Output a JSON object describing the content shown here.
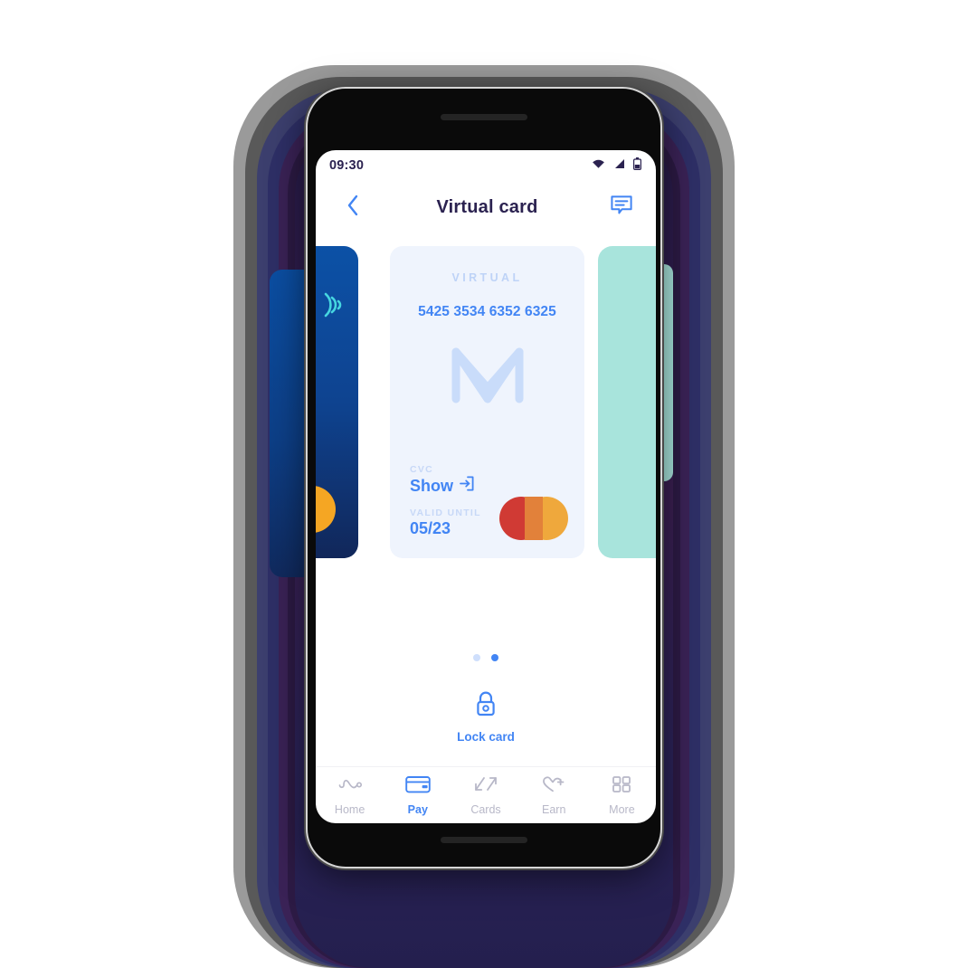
{
  "background": {
    "ring_colors": [
      "#ffffff",
      "#9a9a9a",
      "#595959",
      "#3c3f6e",
      "#2e2f66",
      "#3a2256",
      "#2c1a44"
    ]
  },
  "status_bar": {
    "time": "09:30",
    "icons": [
      "wifi-icon",
      "cellular-signal-icon",
      "battery-icon"
    ],
    "color": "#2b2250"
  },
  "header": {
    "title": "Virtual card",
    "back_icon": "chevron-left-icon",
    "chat_icon": "chat-bubble-icon",
    "accent": "#4285f4"
  },
  "cards": {
    "previous": {
      "type": "physical-card",
      "contactless_icon": "contactless-icon",
      "scheme_logo": "mastercard-logo",
      "color": "#0e4390"
    },
    "virtual": {
      "kind_label": "VIRTUAL",
      "number": "5425 3534 6352 6325",
      "brand_logo": "monese-m-logo",
      "cvc_label": "CVC",
      "cvc_value": "Show",
      "cvc_reveal_icon": "reveal-icon",
      "valid_label": "VALID UNTIL",
      "valid_value": "05/23",
      "scheme_logo": "mastercard-logo",
      "background": "#eff4fd",
      "text_color": "#4285f4",
      "muted_color": "#c7d8f7"
    },
    "next": {
      "type": "teal-card",
      "color": "#a8e4dc"
    }
  },
  "pagination": {
    "total": 2,
    "active_index": 1
  },
  "lock_action": {
    "label": "Lock card",
    "icon": "padlock-icon",
    "color": "#4285f4"
  },
  "bottom_nav": {
    "items": [
      {
        "label": "Home",
        "icon": "activity-wave-icon",
        "active": false
      },
      {
        "label": "Pay",
        "icon": "credit-card-icon",
        "active": true
      },
      {
        "label": "Cards",
        "icon": "transfer-arrows-icon",
        "active": false
      },
      {
        "label": "Earn",
        "icon": "heart-plus-icon",
        "active": false
      },
      {
        "label": "More",
        "icon": "grid-squares-icon",
        "active": false
      }
    ],
    "active_color": "#4285f4",
    "inactive_color": "#b8b8c8"
  },
  "mastercard_colors": {
    "red": "#d03a34",
    "orange": "#efa83c",
    "overlap": "#e2813a"
  }
}
